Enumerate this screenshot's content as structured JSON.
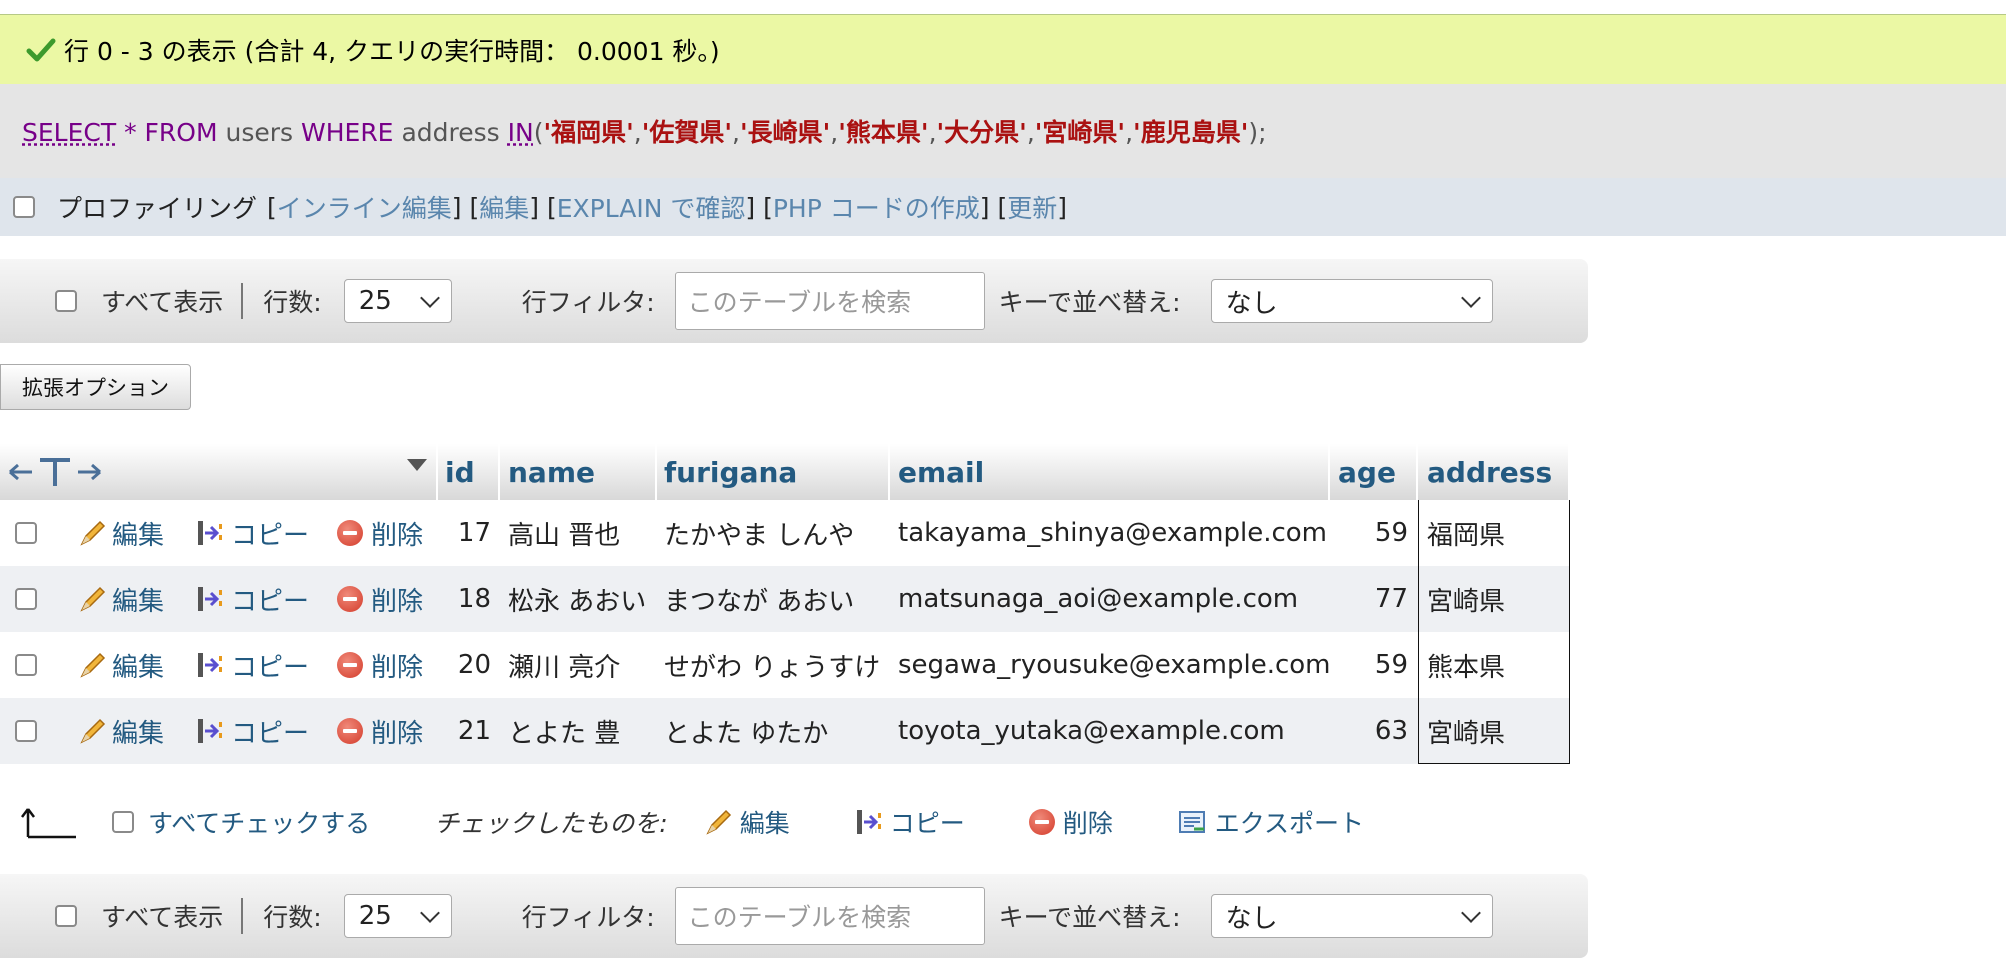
{
  "result_message": "行 0 - 3 の表示 (合計 4, クエリの実行時間： 0.0001 秒。)",
  "sql": {
    "select": "SELECT",
    "star": "*",
    "from": "FROM",
    "table": "users",
    "where": "WHERE",
    "column": "address",
    "in": "IN",
    "open": "(",
    "values": [
      "'福岡県'",
      "'佐賀県'",
      "'長崎県'",
      "'熊本県'",
      "'大分県'",
      "'宮崎県'",
      "'鹿児島県'"
    ],
    "close": ");"
  },
  "profiling": {
    "label": "プロファイリング",
    "links": [
      "インライン編集",
      "編集",
      "EXPLAIN で確認",
      "PHP コードの作成",
      "更新"
    ]
  },
  "nav": {
    "show_all": "すべて表示",
    "rows_label": "行数:",
    "rows_value": "25",
    "filter_label": "行フィルタ:",
    "filter_placeholder": "このテーブルを検索",
    "sort_label": "キーで並べ替え:",
    "sort_value": "なし"
  },
  "options_button": "拡張オプション",
  "table": {
    "arrows": "←T→",
    "columns": [
      "id",
      "name",
      "furigana",
      "email",
      "age",
      "address"
    ],
    "actions": {
      "edit": "編集",
      "copy": "コピー",
      "delete": "削除"
    },
    "rows": [
      {
        "id": "17",
        "name": "高山 晋也",
        "furigana": "たかやま しんや",
        "email": "takayama_shinya@example.com",
        "age": "59",
        "address": "福岡県"
      },
      {
        "id": "18",
        "name": "松永 あおい",
        "furigana": "まつなが あおい",
        "email": "matsunaga_aoi@example.com",
        "age": "77",
        "address": "宮崎県"
      },
      {
        "id": "20",
        "name": "瀬川 亮介",
        "furigana": "せがわ りょうすけ",
        "email": "segawa_ryousuke@example.com",
        "age": "59",
        "address": "熊本県"
      },
      {
        "id": "21",
        "name": "とよた 豊",
        "furigana": "とよた ゆたか",
        "email": "toyota_yutaka@example.com",
        "age": "63",
        "address": "宮崎県"
      }
    ]
  },
  "footer": {
    "check_all": "すべてチェックする",
    "with_selected": "チェックしたものを:",
    "edit": "編集",
    "copy": "コピー",
    "delete": "削除",
    "export": "エクスポート"
  }
}
